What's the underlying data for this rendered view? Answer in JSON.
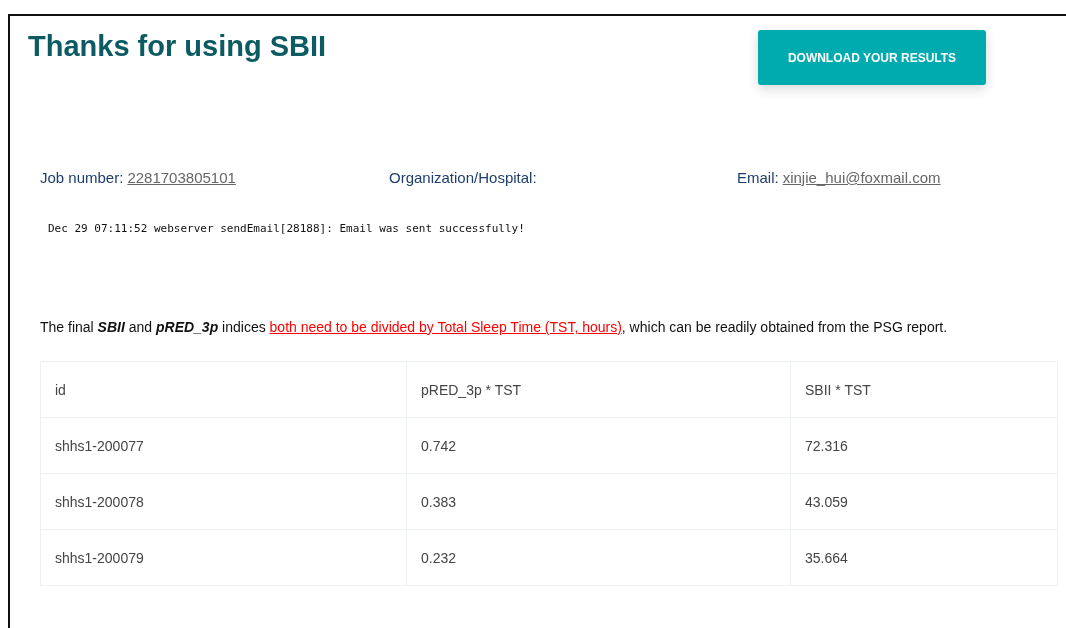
{
  "title": "Thanks for using SBII",
  "download_button": "DOWNLOAD YOUR RESULTS",
  "info": [
    {
      "label": "Job number:",
      "value": "2281703805101"
    },
    {
      "label": "Organization/Hospital:"
    },
    {
      "label": "Email:",
      "value": "xinjie_hui@foxmail.com"
    }
  ],
  "log_line": "Dec 29 07:11:52 webserver sendEmail[28188]: Email was sent successfully!",
  "note": [
    {
      "kind": "plain",
      "text": "The final "
    },
    {
      "kind": "emphasis",
      "text": "SBII"
    },
    {
      "kind": "plain",
      "text": " and "
    },
    {
      "kind": "emphasis",
      "text": "pRED_3p"
    },
    {
      "kind": "plain",
      "text": " indices "
    },
    {
      "kind": "link",
      "text": "both need to be divided by Total Sleep Time (TST, hours)"
    },
    {
      "kind": "plain",
      "text": ", which can be readily obtained from the PSG report."
    }
  ],
  "table": {
    "columns": [
      "id",
      "pRED_3p * TST",
      "SBII * TST"
    ],
    "rows": [
      [
        "shhs1-200077",
        "0.742",
        "72.316"
      ],
      [
        "shhs1-200078",
        "0.383",
        "43.059"
      ],
      [
        "shhs1-200079",
        "0.232",
        "35.664"
      ]
    ]
  }
}
